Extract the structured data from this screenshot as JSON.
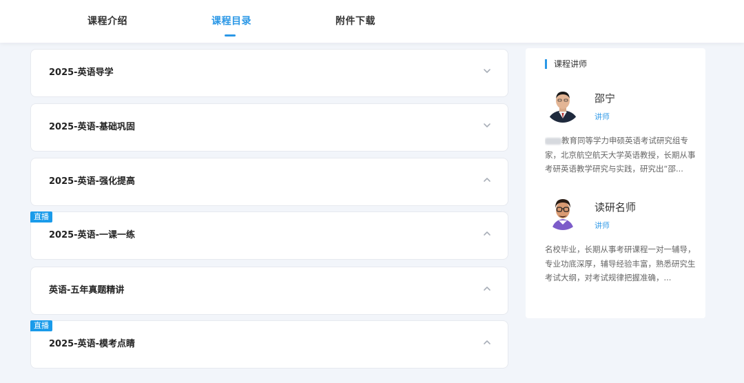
{
  "tabs": [
    {
      "label": "课程介绍",
      "active": false
    },
    {
      "label": "课程目录",
      "active": true
    },
    {
      "label": "附件下载",
      "active": false
    }
  ],
  "courses": [
    {
      "title": "2025-英语导学",
      "expanded": false,
      "live": false
    },
    {
      "title": "2025-英语-基础巩固",
      "expanded": false,
      "live": false
    },
    {
      "title": "2025-英语-强化提高",
      "expanded": true,
      "live": false
    },
    {
      "title": "2025-英语-一课一练",
      "expanded": true,
      "live": true
    },
    {
      "title": "英语-五年真题精讲",
      "expanded": true,
      "live": false
    },
    {
      "title": "2025-英语-模考点睛",
      "expanded": true,
      "live": true
    }
  ],
  "live_badge_label": "直播",
  "sidebar": {
    "heading": "课程讲师",
    "teachers": [
      {
        "name": "邵宁",
        "role": "讲师",
        "description": "教育同等学力申硕英语考试研究组专家，北京航空航天大学英语教授，长期从事考研英语教学研究与实践，研究出“邵..."
      },
      {
        "name": "读研名师",
        "role": "讲师",
        "description": "名校毕业，长期从事考研课程一对一辅导，专业功底深厚，辅导经验丰富，熟悉研究生考试大纲，对考试规律把握准确，..."
      }
    ]
  },
  "colors": {
    "accent": "#2a97e6",
    "live_badge": "#1a9bea",
    "page_bg": "#f2f5fa"
  }
}
